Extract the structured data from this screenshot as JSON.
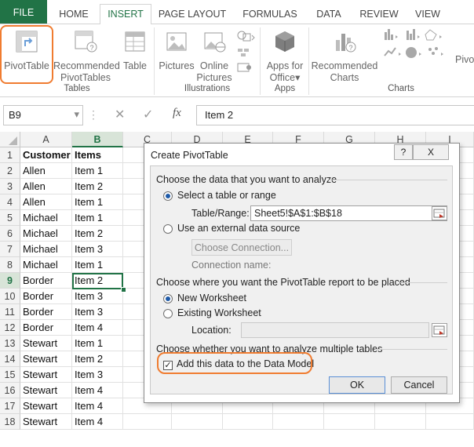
{
  "ribbon": {
    "tabs": [
      "FILE",
      "HOME",
      "INSERT",
      "PAGE LAYOUT",
      "FORMULAS",
      "DATA",
      "REVIEW",
      "VIEW"
    ],
    "active_tab": "INSERT",
    "buttons": {
      "pivottable": "PivotTable",
      "recommended_pivottables": [
        "Recommended",
        "PivotTables"
      ],
      "table": "Table",
      "pictures": "Pictures",
      "online_pictures": [
        "Online",
        "Pictures"
      ],
      "apps_for_office": [
        "Apps for",
        "Office"
      ],
      "recommended_charts": [
        "Recommended",
        "Charts"
      ],
      "pivotchart_partial": "Pivo"
    },
    "groups": {
      "tables": "Tables",
      "illustrations": "Illustrations",
      "apps": "Apps",
      "charts": "Charts"
    }
  },
  "formula_bar": {
    "name_box": "B9",
    "fx": "fx",
    "value": "Item 2"
  },
  "sheet": {
    "columns": [
      "A",
      "B",
      "C",
      "D",
      "E",
      "F",
      "G",
      "H",
      "I"
    ],
    "rows": [
      [
        "Customer",
        "Items"
      ],
      [
        "Allen",
        "Item 1"
      ],
      [
        "Allen",
        "Item 2"
      ],
      [
        "Allen",
        "Item 1"
      ],
      [
        "Michael",
        "Item 1"
      ],
      [
        "Michael",
        "Item 2"
      ],
      [
        "Michael",
        "Item 3"
      ],
      [
        "Michael",
        "Item 1"
      ],
      [
        "Border",
        "Item 2"
      ],
      [
        "Border",
        "Item 3"
      ],
      [
        "Border",
        "Item 3"
      ],
      [
        "Border",
        "Item 4"
      ],
      [
        "Stewart",
        "Item 1"
      ],
      [
        "Stewart",
        "Item 2"
      ],
      [
        "Stewart",
        "Item 3"
      ],
      [
        "Stewart",
        "Item 4"
      ],
      [
        "Stewart",
        "Item 4"
      ],
      [
        "Stewart",
        "Item 4"
      ]
    ],
    "selected_cell": "B9"
  },
  "dialog": {
    "title": "Create PivotTable",
    "help": "?",
    "close": "X",
    "section1": "Choose the data that you want to analyze",
    "opt_select_range": "Select a table or range",
    "table_range_label": "Table/Range:",
    "table_range_value": "Sheet5!$A$1:$B$18",
    "opt_external": "Use an external data source",
    "choose_connection": "Choose Connection...",
    "connection_name": "Connection name:",
    "section2": "Choose where you want the PivotTable report to be placed",
    "opt_new_ws": "New Worksheet",
    "opt_existing_ws": "Existing Worksheet",
    "location_label": "Location:",
    "section3": "Choose whether you want to analyze multiple tables",
    "add_data_model": "Add this data to the Data Model",
    "ok": "OK",
    "cancel": "Cancel"
  },
  "colors": {
    "excel_green": "#217346",
    "highlight": "#f07c30",
    "radio": "#1e5aa8"
  }
}
